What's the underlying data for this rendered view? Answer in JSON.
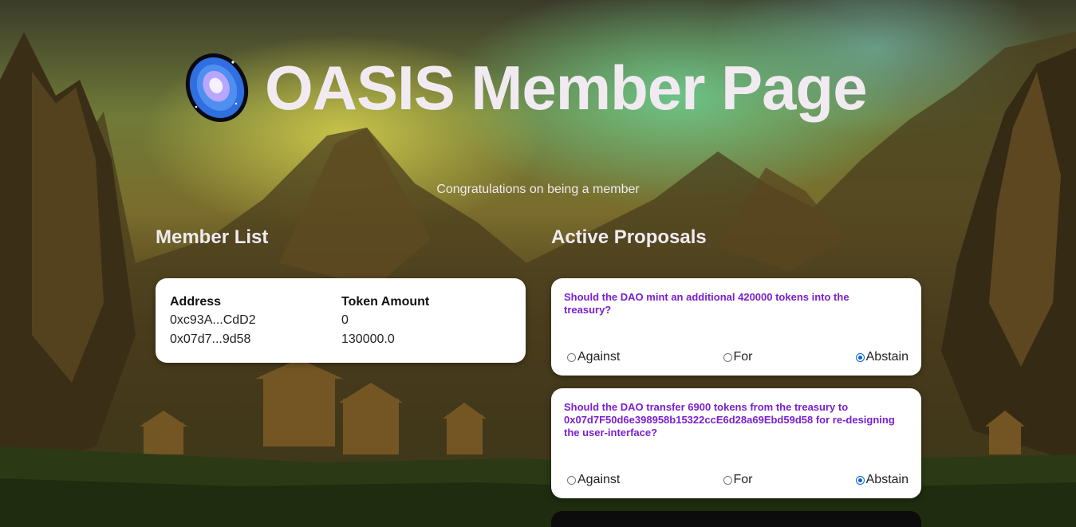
{
  "header": {
    "title": "OASIS Member Page",
    "logo_icon": "galaxy-disc-icon"
  },
  "subtitle": "Congratulations on being a member",
  "member_list": {
    "title": "Member List",
    "columns": [
      "Address",
      "Token Amount"
    ],
    "rows": [
      [
        "0xc93A...CdD2",
        "0"
      ],
      [
        "0x07d7...9d58",
        "130000.0"
      ]
    ]
  },
  "proposals": {
    "title": "Active Proposals",
    "items": [
      {
        "question": "Should the DAO mint an additional 420000 tokens into the treasury?",
        "options": [
          "Against",
          "For",
          "Abstain"
        ],
        "selected": "Abstain"
      },
      {
        "question": "Should the DAO transfer 6900 tokens from the treasury to 0x07d7F50d6e398958b15322ccE6d28a69Ebd59d58 for re-designing the user-interface?",
        "options": [
          "Against",
          "For",
          "Abstain"
        ],
        "selected": "Abstain"
      }
    ]
  },
  "colors": {
    "question_text": "#7a1fd0",
    "radio_accent": "#0b63d6",
    "card_bg": "#ffffff"
  }
}
